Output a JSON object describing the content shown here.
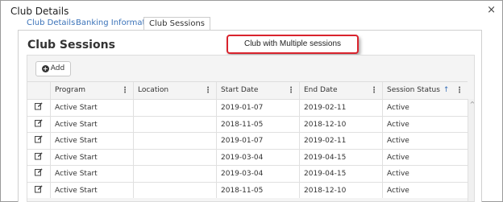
{
  "window": {
    "title": "Club Details",
    "close_glyph": "×"
  },
  "tabs": [
    {
      "label": "Club Details",
      "active": false
    },
    {
      "label": "Banking Information",
      "active": false
    },
    {
      "label": "Club Sessions",
      "active": true
    }
  ],
  "panel": {
    "title": "Club Sessions"
  },
  "callout": {
    "text": "Club with Multiple sessions",
    "border_color": "#d9232d"
  },
  "toolbar": {
    "add_label": "Add",
    "add_icon": "plus-circle-icon"
  },
  "table": {
    "columns": [
      "Program",
      "Location",
      "Start Date",
      "End Date",
      "Session Status"
    ],
    "sorted_column": "Session Status",
    "rows": [
      {
        "program": "Active Start",
        "location": "",
        "start": "2019-01-07",
        "end": "2019-02-11",
        "status": "Active"
      },
      {
        "program": "Active Start",
        "location": "",
        "start": "2018-11-05",
        "end": "2018-12-10",
        "status": "Active"
      },
      {
        "program": "Active Start",
        "location": "",
        "start": "2019-01-07",
        "end": "2019-02-11",
        "status": "Active"
      },
      {
        "program": "Active Start",
        "location": "",
        "start": "2019-03-04",
        "end": "2019-04-15",
        "status": "Active"
      },
      {
        "program": "Active Start",
        "location": "",
        "start": "2019-03-04",
        "end": "2019-04-15",
        "status": "Active"
      },
      {
        "program": "Active Start",
        "location": "",
        "start": "2018-11-05",
        "end": "2018-12-10",
        "status": "Active"
      }
    ]
  },
  "colors": {
    "link": "#3b73b9",
    "accent_red": "#d9232d"
  }
}
